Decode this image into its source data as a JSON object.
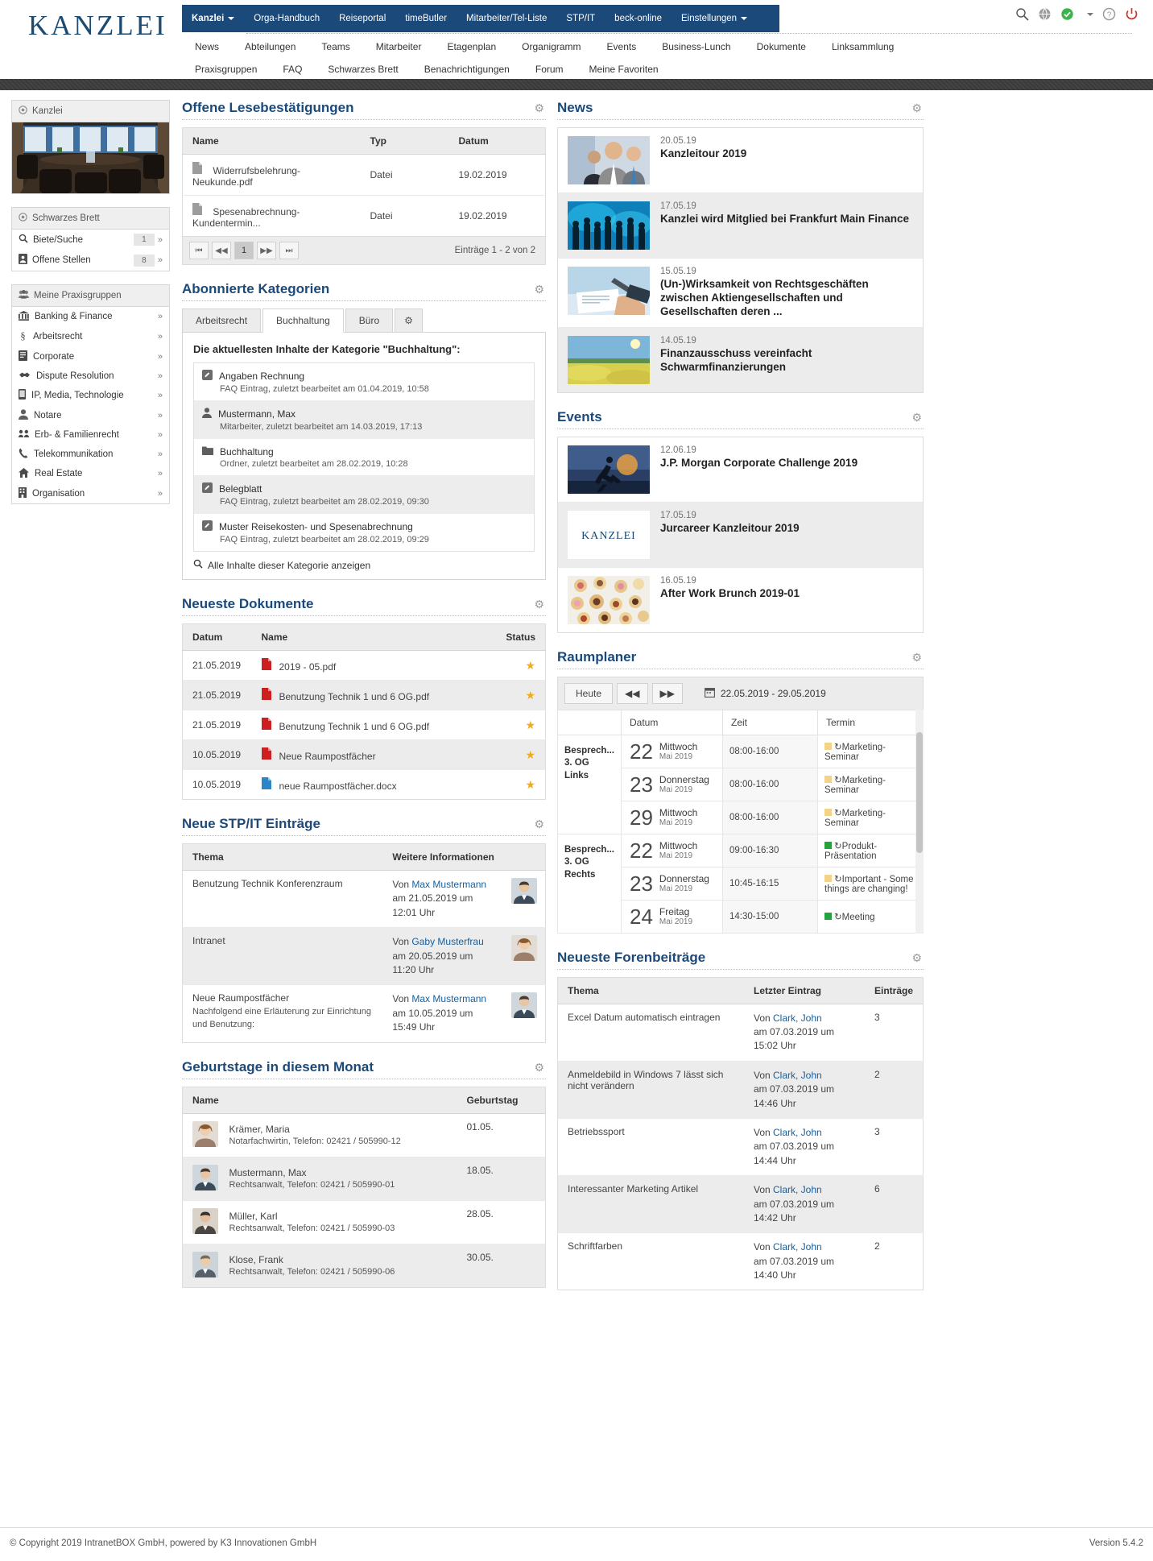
{
  "brand": {
    "logo": "KANZLEI"
  },
  "topnav": {
    "items": [
      {
        "label": "Kanzlei",
        "active": true,
        "caret": true
      },
      {
        "label": "Orga-Handbuch",
        "active": false,
        "caret": false
      },
      {
        "label": "Reiseportal",
        "active": false,
        "caret": false
      },
      {
        "label": "timeButler",
        "active": false,
        "caret": false
      },
      {
        "label": "Mitarbeiter/Tel-Liste",
        "active": false,
        "caret": false
      },
      {
        "label": "STP/IT",
        "active": false,
        "caret": false
      },
      {
        "label": "beck-online",
        "active": false,
        "caret": false
      },
      {
        "label": "Einstellungen",
        "active": false,
        "caret": true
      }
    ],
    "icons": [
      "search-icon",
      "globe-icon",
      "check-circle-icon",
      "help-icon",
      "power-icon"
    ]
  },
  "subnav": {
    "row1": [
      "News",
      "Abteilungen",
      "Teams",
      "Mitarbeiter",
      "Etagenplan",
      "Organigramm",
      "Events",
      "Business-Lunch",
      "Dokumente",
      "Linksammlung"
    ],
    "row2": [
      "Praxisgruppen",
      "FAQ",
      "Schwarzes Brett",
      "Benachrichtigungen",
      "Forum",
      "Meine Favoriten"
    ]
  },
  "sidebar": {
    "kanzlei": {
      "title": "Kanzlei",
      "icon": "target-icon"
    },
    "schwarzes_brett": {
      "title": "Schwarzes Brett",
      "icon": "target-icon",
      "items": [
        {
          "label": "Biete/Suche",
          "badge": "1",
          "icon": "search-icon"
        },
        {
          "label": "Offene Stellen",
          "badge": "8",
          "icon": "id-card-icon"
        }
      ]
    },
    "praxisgruppen": {
      "title": "Meine Praxisgruppen",
      "icon": "users-icon",
      "items": [
        {
          "label": "Banking & Finance",
          "icon": "bank-icon"
        },
        {
          "label": "Arbeitsrecht",
          "icon": "section-sign-icon"
        },
        {
          "label": "Corporate",
          "icon": "document-icon"
        },
        {
          "label": "Dispute Resolution",
          "icon": "handshake-icon"
        },
        {
          "label": "IP, Media, Technologie",
          "icon": "mobile-icon"
        },
        {
          "label": "Notare",
          "icon": "person-icon"
        },
        {
          "label": "Erb- & Familienrecht",
          "icon": "users-icon"
        },
        {
          "label": "Telekommunikation",
          "icon": "phone-icon"
        },
        {
          "label": "Real Estate",
          "icon": "home-icon"
        },
        {
          "label": "Organisation",
          "icon": "building-icon"
        }
      ]
    }
  },
  "lesebestaetigungen": {
    "title": "Offene Lesebestätigungen",
    "gear": "gear-icon",
    "columns": [
      "Name",
      "Typ",
      "Datum"
    ],
    "rows": [
      {
        "name": "Widerrufsbelehrung-Neukunde.pdf",
        "typ": "Datei",
        "datum": "19.02.2019",
        "icon": "file-icon"
      },
      {
        "name": "Spesenabrechnung-Kundentermin...",
        "typ": "Datei",
        "datum": "19.02.2019",
        "icon": "file-icon"
      }
    ],
    "pager": {
      "first": "⏮",
      "prev": "◀◀",
      "page": "1",
      "next": "▶▶",
      "last": "⏭",
      "count": "Einträge 1 - 2 von 2"
    }
  },
  "kategorien": {
    "title": "Abonnierte Kategorien",
    "gear": "gear-icon",
    "tabs": [
      {
        "label": "Arbeitsrecht",
        "active": false
      },
      {
        "label": "Buchhaltung",
        "active": true
      },
      {
        "label": "Büro",
        "active": false
      }
    ],
    "tab_gear": "gear-icon",
    "body_title": "Die aktuellesten Inhalte der Kategorie \"Buchhaltung\":",
    "entries": [
      {
        "title": "Angaben Rechnung",
        "sub": "FAQ Eintrag, zuletzt bearbeitet am 01.04.2019, 10:58",
        "icon": "edit-icon"
      },
      {
        "title": "Mustermann, Max",
        "sub": "Mitarbeiter, zuletzt bearbeitet am 14.03.2019, 17:13",
        "icon": "person-icon"
      },
      {
        "title": "Buchhaltung",
        "sub": "Ordner, zuletzt bearbeitet am 28.02.2019, 10:28",
        "icon": "folder-icon"
      },
      {
        "title": "Belegblatt",
        "sub": "FAQ Eintrag, zuletzt bearbeitet am 28.02.2019, 09:30",
        "icon": "edit-icon"
      },
      {
        "title": "Muster Reisekosten- und Spesenabrechnung",
        "sub": "FAQ Eintrag, zuletzt bearbeitet am 28.02.2019, 09:29",
        "icon": "edit-icon"
      }
    ],
    "all_link": "Alle Inhalte dieser Kategorie anzeigen",
    "all_link_icon": "search-icon"
  },
  "dokumente": {
    "title": "Neueste Dokumente",
    "gear": "gear-icon",
    "columns": [
      "Datum",
      "Name",
      "Status"
    ],
    "rows": [
      {
        "datum": "21.05.2019",
        "name": "2019 - 05.pdf",
        "status": "★",
        "icon": "pdf-icon"
      },
      {
        "datum": "21.05.2019",
        "name": "Benutzung Technik 1 und 6 OG.pdf",
        "status": "★",
        "icon": "pdf-icon"
      },
      {
        "datum": "21.05.2019",
        "name": "Benutzung Technik 1 und 6 OG.pdf",
        "status": "★",
        "icon": "pdf-icon"
      },
      {
        "datum": "10.05.2019",
        "name": "Neue Raumpostfächer",
        "status": "★",
        "icon": "pdf-icon"
      },
      {
        "datum": "10.05.2019",
        "name": "neue Raumpostfächer.docx",
        "status": "★",
        "icon": "doc-icon"
      }
    ]
  },
  "stpit": {
    "title": "Neue STP/IT Einträge",
    "gear": "gear-icon",
    "columns": [
      "Thema",
      "Weitere Informationen"
    ],
    "rows": [
      {
        "thema": "Benutzung Technik Konferenzraum",
        "sub": "",
        "von": "Von ",
        "author": "Max Mustermann",
        "when": "am 21.05.2019 um 12:01 Uhr",
        "avatar": "avatar-male"
      },
      {
        "thema": "Intranet",
        "sub": "",
        "von": "Von ",
        "author": "Gaby Musterfrau",
        "when": "am 20.05.2019 um 11:20 Uhr",
        "avatar": "avatar-female"
      },
      {
        "thema": "Neue Raumpostfächer",
        "sub": "Nachfolgend eine Erläuterung zur Einrichtung und Benutzung:",
        "von": "Von ",
        "author": "Max Mustermann",
        "when": "am 10.05.2019 um 15:49 Uhr",
        "avatar": "avatar-male"
      }
    ]
  },
  "geburtstage": {
    "title": "Geburtstage in diesem Monat",
    "gear": "gear-icon",
    "columns": [
      "Name",
      "Geburtstag"
    ],
    "rows": [
      {
        "name": "Krämer, Maria",
        "sub": "Notarfachwirtin, Telefon: 02421 / 505990-12",
        "date": "01.05.",
        "avatar": "avatar-female"
      },
      {
        "name": "Mustermann, Max",
        "sub": "Rechtsanwalt, Telefon: 02421 / 505990-01",
        "date": "18.05.",
        "avatar": "avatar-male"
      },
      {
        "name": "Müller, Karl",
        "sub": "Rechtsanwalt, Telefon: 02421 / 505990-03",
        "date": "28.05.",
        "avatar": "avatar-male2"
      },
      {
        "name": "Klose, Frank",
        "sub": "Rechtsanwalt, Telefon: 02421 / 505990-06",
        "date": "30.05.",
        "avatar": "avatar-male3"
      }
    ]
  },
  "news": {
    "title": "News",
    "gear": "gear-icon",
    "items": [
      {
        "date": "20.05.19",
        "headline": "Kanzleitour 2019",
        "thumb": "people-business"
      },
      {
        "date": "17.05.19",
        "headline": "Kanzlei wird Mitglied bei Frankfurt Main Finance",
        "thumb": "crowd-silhouette"
      },
      {
        "date": "15.05.19",
        "headline": "(Un-)Wirksamkeit von Rechtsgeschäften zwischen Aktiengesellschaften und Gesellschaften deren ...",
        "thumb": "signing-hands"
      },
      {
        "date": "14.05.19",
        "headline": "Finanzausschuss vereinfacht Schwarmfinanzierungen",
        "thumb": "field-landscape"
      }
    ]
  },
  "events": {
    "title": "Events",
    "gear": "gear-icon",
    "items": [
      {
        "date": "12.06.19",
        "headline": "J.P. Morgan Corporate Challenge 2019",
        "thumb": "runner-sunset"
      },
      {
        "date": "17.05.19",
        "headline": "Jurcareer Kanzleitour 2019",
        "thumb": "kanzlei-logo"
      },
      {
        "date": "16.05.19",
        "headline": "After Work Brunch 2019-01",
        "thumb": "canapes"
      }
    ]
  },
  "raumplaner": {
    "title": "Raumplaner",
    "gear": "gear-icon",
    "toolbar": {
      "today": "Heute",
      "prev": "◀◀",
      "next": "▶▶",
      "calendar_icon": "calendar-icon",
      "range": "22.05.2019 - 29.05.2019",
      "refresh_icon": "refresh-icon"
    },
    "columns": [
      "",
      "Datum",
      "Zeit",
      "Termin"
    ],
    "groups": [
      {
        "room": "Besprech...\n3. OG Links",
        "rows": [
          {
            "day": "22",
            "weekday": "Mittwoch",
            "month": "Mai 2019",
            "zeit": "08:00-16:00",
            "color": "#f2d389",
            "termin": "Marketing-Seminar",
            "recur": "↻"
          },
          {
            "day": "23",
            "weekday": "Donnerstag",
            "month": "Mai 2019",
            "zeit": "08:00-16:00",
            "color": "#f2d389",
            "termin": "Marketing-Seminar",
            "recur": "↻"
          },
          {
            "day": "29",
            "weekday": "Mittwoch",
            "month": "Mai 2019",
            "zeit": "08:00-16:00",
            "color": "#f2d389",
            "termin": "Marketing-Seminar",
            "recur": "↻"
          }
        ]
      },
      {
        "room": "Besprech...\n3. OG Rechts",
        "rows": [
          {
            "day": "22",
            "weekday": "Mittwoch",
            "month": "Mai 2019",
            "zeit": "09:00-16:30",
            "color": "#23a33a",
            "termin": "Produkt-Präsentation",
            "recur": "↻"
          },
          {
            "day": "23",
            "weekday": "Donnerstag",
            "month": "Mai 2019",
            "zeit": "10:45-16:15",
            "color": "#f2d389",
            "termin": "Important - Some things are changing!",
            "recur": "↻"
          },
          {
            "day": "24",
            "weekday": "Freitag",
            "month": "Mai 2019",
            "zeit": "14:30-15:00",
            "color": "#23a33a",
            "termin": "Meeting",
            "recur": "↻"
          }
        ]
      }
    ]
  },
  "foren": {
    "title": "Neueste Forenbeiträge",
    "gear": "gear-icon",
    "columns": [
      "Thema",
      "Letzter Eintrag",
      "Einträge"
    ],
    "rows": [
      {
        "thema": "Excel Datum automatisch eintragen",
        "von": "Von ",
        "author": "Clark, John",
        "when": "am 07.03.2019 um 15:02 Uhr",
        "count": "3"
      },
      {
        "thema": "Anmeldebild in Windows 7 lässt sich nicht verändern",
        "von": "Von ",
        "author": "Clark, John",
        "when": "am 07.03.2019 um 14:46 Uhr",
        "count": "2"
      },
      {
        "thema": "Betriebssport",
        "von": "Von ",
        "author": "Clark, John",
        "when": "am 07.03.2019 um 14:44 Uhr",
        "count": "3"
      },
      {
        "thema": "Interessanter Marketing Artikel",
        "von": "Von ",
        "author": "Clark, John",
        "when": "am 07.03.2019 um 14:42 Uhr",
        "count": "6"
      },
      {
        "thema": "Schriftfarben",
        "von": "Von ",
        "author": "Clark, John",
        "when": "am 07.03.2019 um 14:40 Uhr",
        "count": "2"
      }
    ]
  },
  "footer": {
    "copyright": "© Copyright 2019 IntranetBOX GmbH, powered by K3 Innovationen GmbH",
    "version": "Version 5.4.2"
  }
}
